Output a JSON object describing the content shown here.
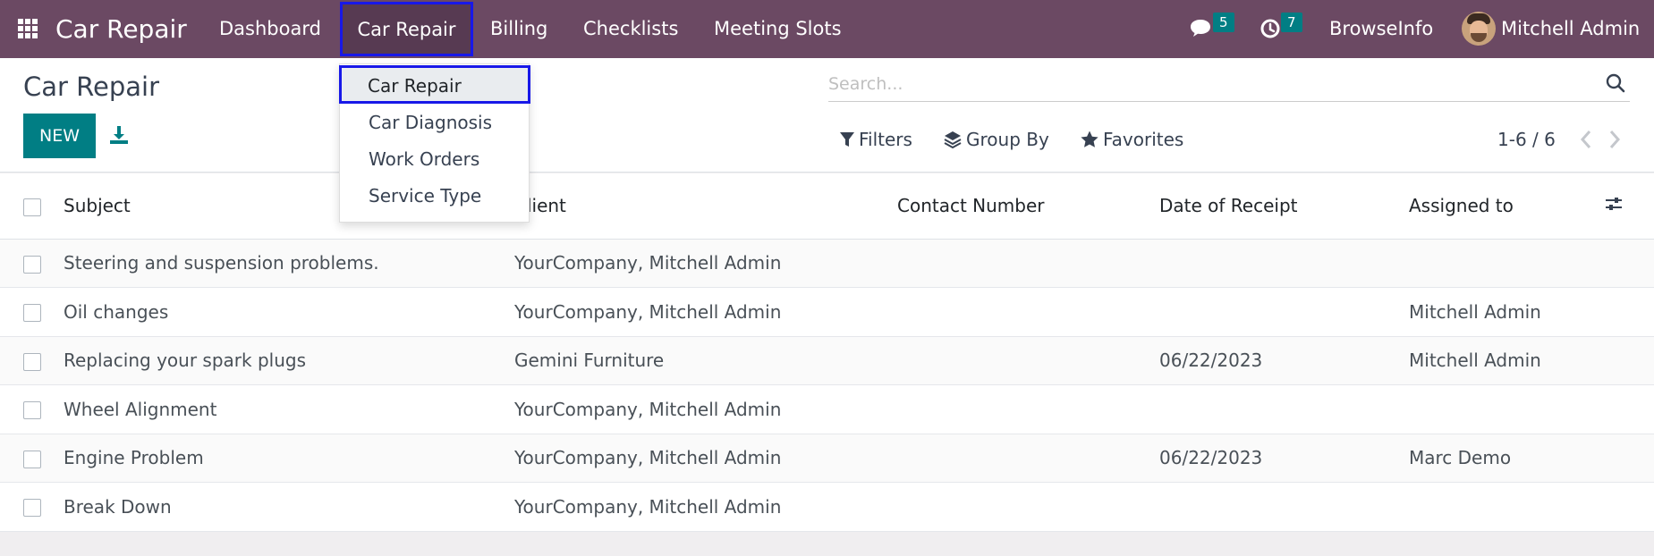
{
  "navbar": {
    "app_title": "Car Repair",
    "menus": {
      "dashboard": "Dashboard",
      "car_repair": "Car Repair",
      "billing": "Billing",
      "checklists": "Checklists",
      "meeting_slots": "Meeting Slots"
    },
    "messages_count": "5",
    "activities_count": "7",
    "company": "BrowseInfo",
    "user": "Mitchell Admin",
    "colors": {
      "bar": "#6b4963",
      "badge": "#017e84",
      "highlight": "#1818e8"
    }
  },
  "dropdown": {
    "items": [
      "Car Repair",
      "Car Diagnosis",
      "Work Orders",
      "Service Type"
    ]
  },
  "control_panel": {
    "title": "Car Repair",
    "new_label": "NEW",
    "search_placeholder": "Search...",
    "filters_label": "Filters",
    "groupby_label": "Group By",
    "favorites_label": "Favorites",
    "pager": "1-6 / 6"
  },
  "table": {
    "headers": {
      "subject": "Subject",
      "client": "Client",
      "contact": "Contact Number",
      "date": "Date of Receipt",
      "assigned": "Assigned to"
    },
    "rows": [
      {
        "subject": "Steering and suspension problems.",
        "client": "YourCompany, Mitchell Admin",
        "contact": "",
        "date": "",
        "assigned": ""
      },
      {
        "subject": "Oil changes",
        "client": "YourCompany, Mitchell Admin",
        "contact": "",
        "date": "",
        "assigned": "Mitchell Admin"
      },
      {
        "subject": "Replacing your spark plugs",
        "client": "Gemini Furniture",
        "contact": "",
        "date": "06/22/2023",
        "assigned": "Mitchell Admin"
      },
      {
        "subject": "Wheel Alignment",
        "client": "YourCompany, Mitchell Admin",
        "contact": "",
        "date": "",
        "assigned": ""
      },
      {
        "subject": "Engine Problem",
        "client": "YourCompany, Mitchell Admin",
        "contact": "",
        "date": "06/22/2023",
        "assigned": "Marc Demo"
      },
      {
        "subject": "Break Down",
        "client": "YourCompany, Mitchell Admin",
        "contact": "",
        "date": "",
        "assigned": ""
      }
    ]
  }
}
